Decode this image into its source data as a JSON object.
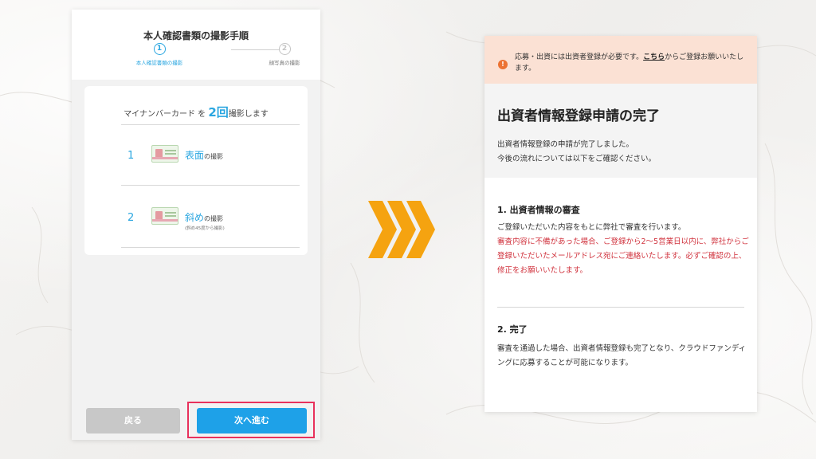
{
  "left_phone": {
    "title": "本人確認書類の撮影手順",
    "steps": [
      {
        "num": "1",
        "label": "本人確認書類の撮影"
      },
      {
        "num": "2",
        "label": "顔写真の撮影"
      }
    ],
    "card": {
      "head_pre": "マイナンバーカード を ",
      "head_num": "2",
      "head_kai": "回",
      "head_post": "撮影します",
      "items": [
        {
          "num": "1",
          "emph": "表面",
          "rest": "の撮影",
          "sub": ""
        },
        {
          "num": "2",
          "emph": "斜め",
          "rest": "の撮影",
          "sub": "(斜め45度から撮影)"
        }
      ]
    },
    "back_label": "戻る",
    "next_label": "次へ進む"
  },
  "right_phone": {
    "alert": {
      "pre": "応募・出資には出資者登録が必要です。",
      "link": "こちら",
      "post": "からご登録お願いいたします。"
    },
    "title": "出資者情報登録申請の完了",
    "lead_1": "出資者情報登録の申請が完了しました。",
    "lead_2": "今後の流れについては以下をご確認ください。",
    "sections": [
      {
        "heading": "1. 出資者情報の審査",
        "body": "ご登録いただいた内容をもとに弊社で審査を行います。",
        "warning": "審査内容に不備があった場合、ご登録から2〜5営業日以内に、弊社からご登録いただいたメールアドレス宛にご連絡いたします。必ずご確認の上、修正をお願いいたします。"
      },
      {
        "heading": "2. 完了",
        "body": "審査を通過した場合、出資者情報登録も完了となり、クラウドファンディングに応募することが可能になります。"
      }
    ]
  },
  "colors": {
    "accent_blue": "#1ea1e8",
    "highlight_frame": "#e8315c",
    "arrow_orange": "#f5a310",
    "alert_bg": "#fbe1d4",
    "alert_icon": "#ec7232",
    "warning_red": "#d0313c"
  },
  "icons": [
    "info-icon",
    "id-card-icon",
    "chevron-right-icon"
  ]
}
